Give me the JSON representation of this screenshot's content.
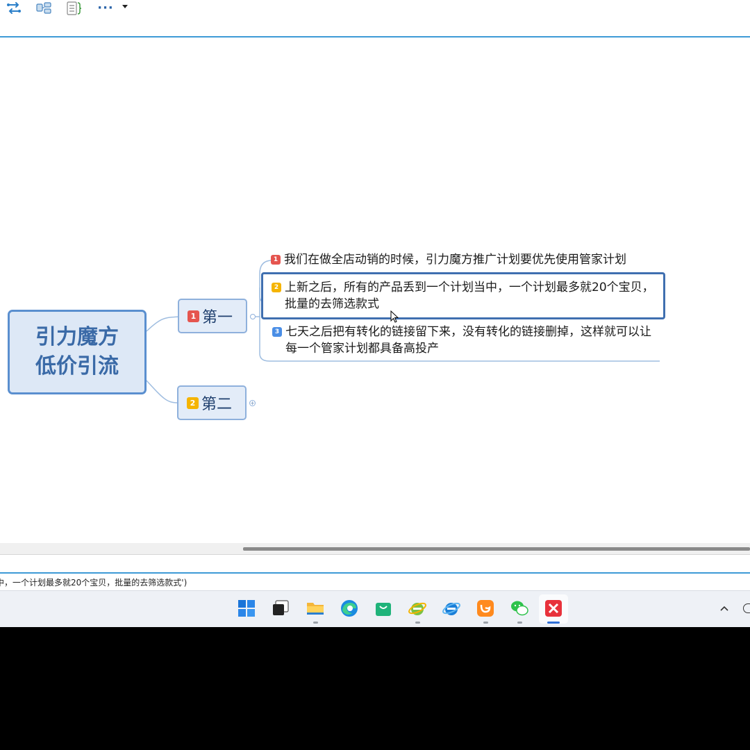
{
  "toolbar": {
    "items": [
      "layout-swap-icon",
      "structure-icon",
      "outline-icon"
    ],
    "more_label": "···"
  },
  "mindmap": {
    "central_topic": "引力魔方\n低价引流",
    "branches": [
      {
        "badge": "1",
        "label": "第一",
        "badge_color": "#e5554f"
      },
      {
        "badge": "2",
        "label": "第二",
        "badge_color": "#f5b400"
      }
    ],
    "subtopics": [
      {
        "badge": "1",
        "text": "我们在做全店动销的时候，引力魔方推广计划要优先使用管家计划",
        "badge_color": "#e5554f"
      },
      {
        "badge": "2",
        "text": "上新之后，所有的产品丢到一个计划当中，一个计划最多就20个宝贝，批量的去筛选款式",
        "badge_color": "#f5b400"
      },
      {
        "badge": "3",
        "text": "七天之后把有转化的链接留下来，没有转化的链接删掉，这样就可以让每一个管家计划都具备高投产",
        "badge_color": "#4a8ee6"
      }
    ],
    "selected_subtopic": 1
  },
  "status_bar": {
    "text": "中，一个计划最多就20个宝贝，批量的去筛选款式')"
  },
  "taskbar": {
    "apps": [
      "windows-start-icon",
      "task-view-icon",
      "file-explorer-icon",
      "edge-browser-icon",
      "shopping-bag-icon",
      "ie-browser-icon",
      "ie-blue-icon",
      "uc-browser-icon",
      "wechat-icon",
      "xmind-icon"
    ],
    "active_app": "xmind-icon"
  },
  "colors": {
    "accent": "#3d9ad6",
    "topic_border": "#5a8fcf",
    "topic_fill": "#dde8f6"
  }
}
